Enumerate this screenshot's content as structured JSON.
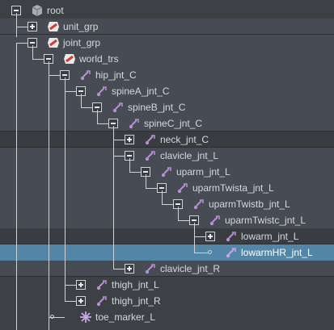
{
  "outliner": {
    "nodes": [
      {
        "label": "root",
        "icon": "group-icon"
      },
      {
        "label": "unit_grp",
        "icon": "transform-icon"
      },
      {
        "label": "joint_grp",
        "icon": "transform-icon"
      },
      {
        "label": "world_trs",
        "icon": "transform-icon"
      },
      {
        "label": "hip_jnt_C",
        "icon": "joint-icon"
      },
      {
        "label": "spineA_jnt_C",
        "icon": "joint-icon"
      },
      {
        "label": "spineB_jnt_C",
        "icon": "joint-icon"
      },
      {
        "label": "spineC_jnt_C",
        "icon": "joint-icon"
      },
      {
        "label": "neck_jnt_C",
        "icon": "joint-icon"
      },
      {
        "label": "clavicle_jnt_L",
        "icon": "joint-icon"
      },
      {
        "label": "uparm_jnt_L",
        "icon": "joint-icon"
      },
      {
        "label": "uparmTwista_jnt_L",
        "icon": "joint-icon"
      },
      {
        "label": "uparmTwistb_jnt_L",
        "icon": "joint-icon"
      },
      {
        "label": "uparmTwistc_jnt_L",
        "icon": "joint-icon"
      },
      {
        "label": "lowarm_jnt_L",
        "icon": "joint-icon"
      },
      {
        "label": "lowarmHR_jnt_L",
        "icon": "joint-icon",
        "selected": true
      },
      {
        "label": "",
        "icon": ""
      },
      {
        "label": "clavicle_jnt_R",
        "icon": "joint-icon"
      },
      {
        "label": "thigh_jnt_L",
        "icon": "joint-icon"
      },
      {
        "label": "thigh_jnt_R",
        "icon": "joint-icon"
      },
      {
        "label": "toe_marker_L",
        "icon": "locator-icon"
      }
    ]
  },
  "colors": {
    "background": "#3d4146",
    "row_alt": "#464b54",
    "selection": "#5285a6",
    "joint_icon": "#b78fd4",
    "transform_icon_red": "#d23a3a",
    "text": "#d7d9db"
  }
}
